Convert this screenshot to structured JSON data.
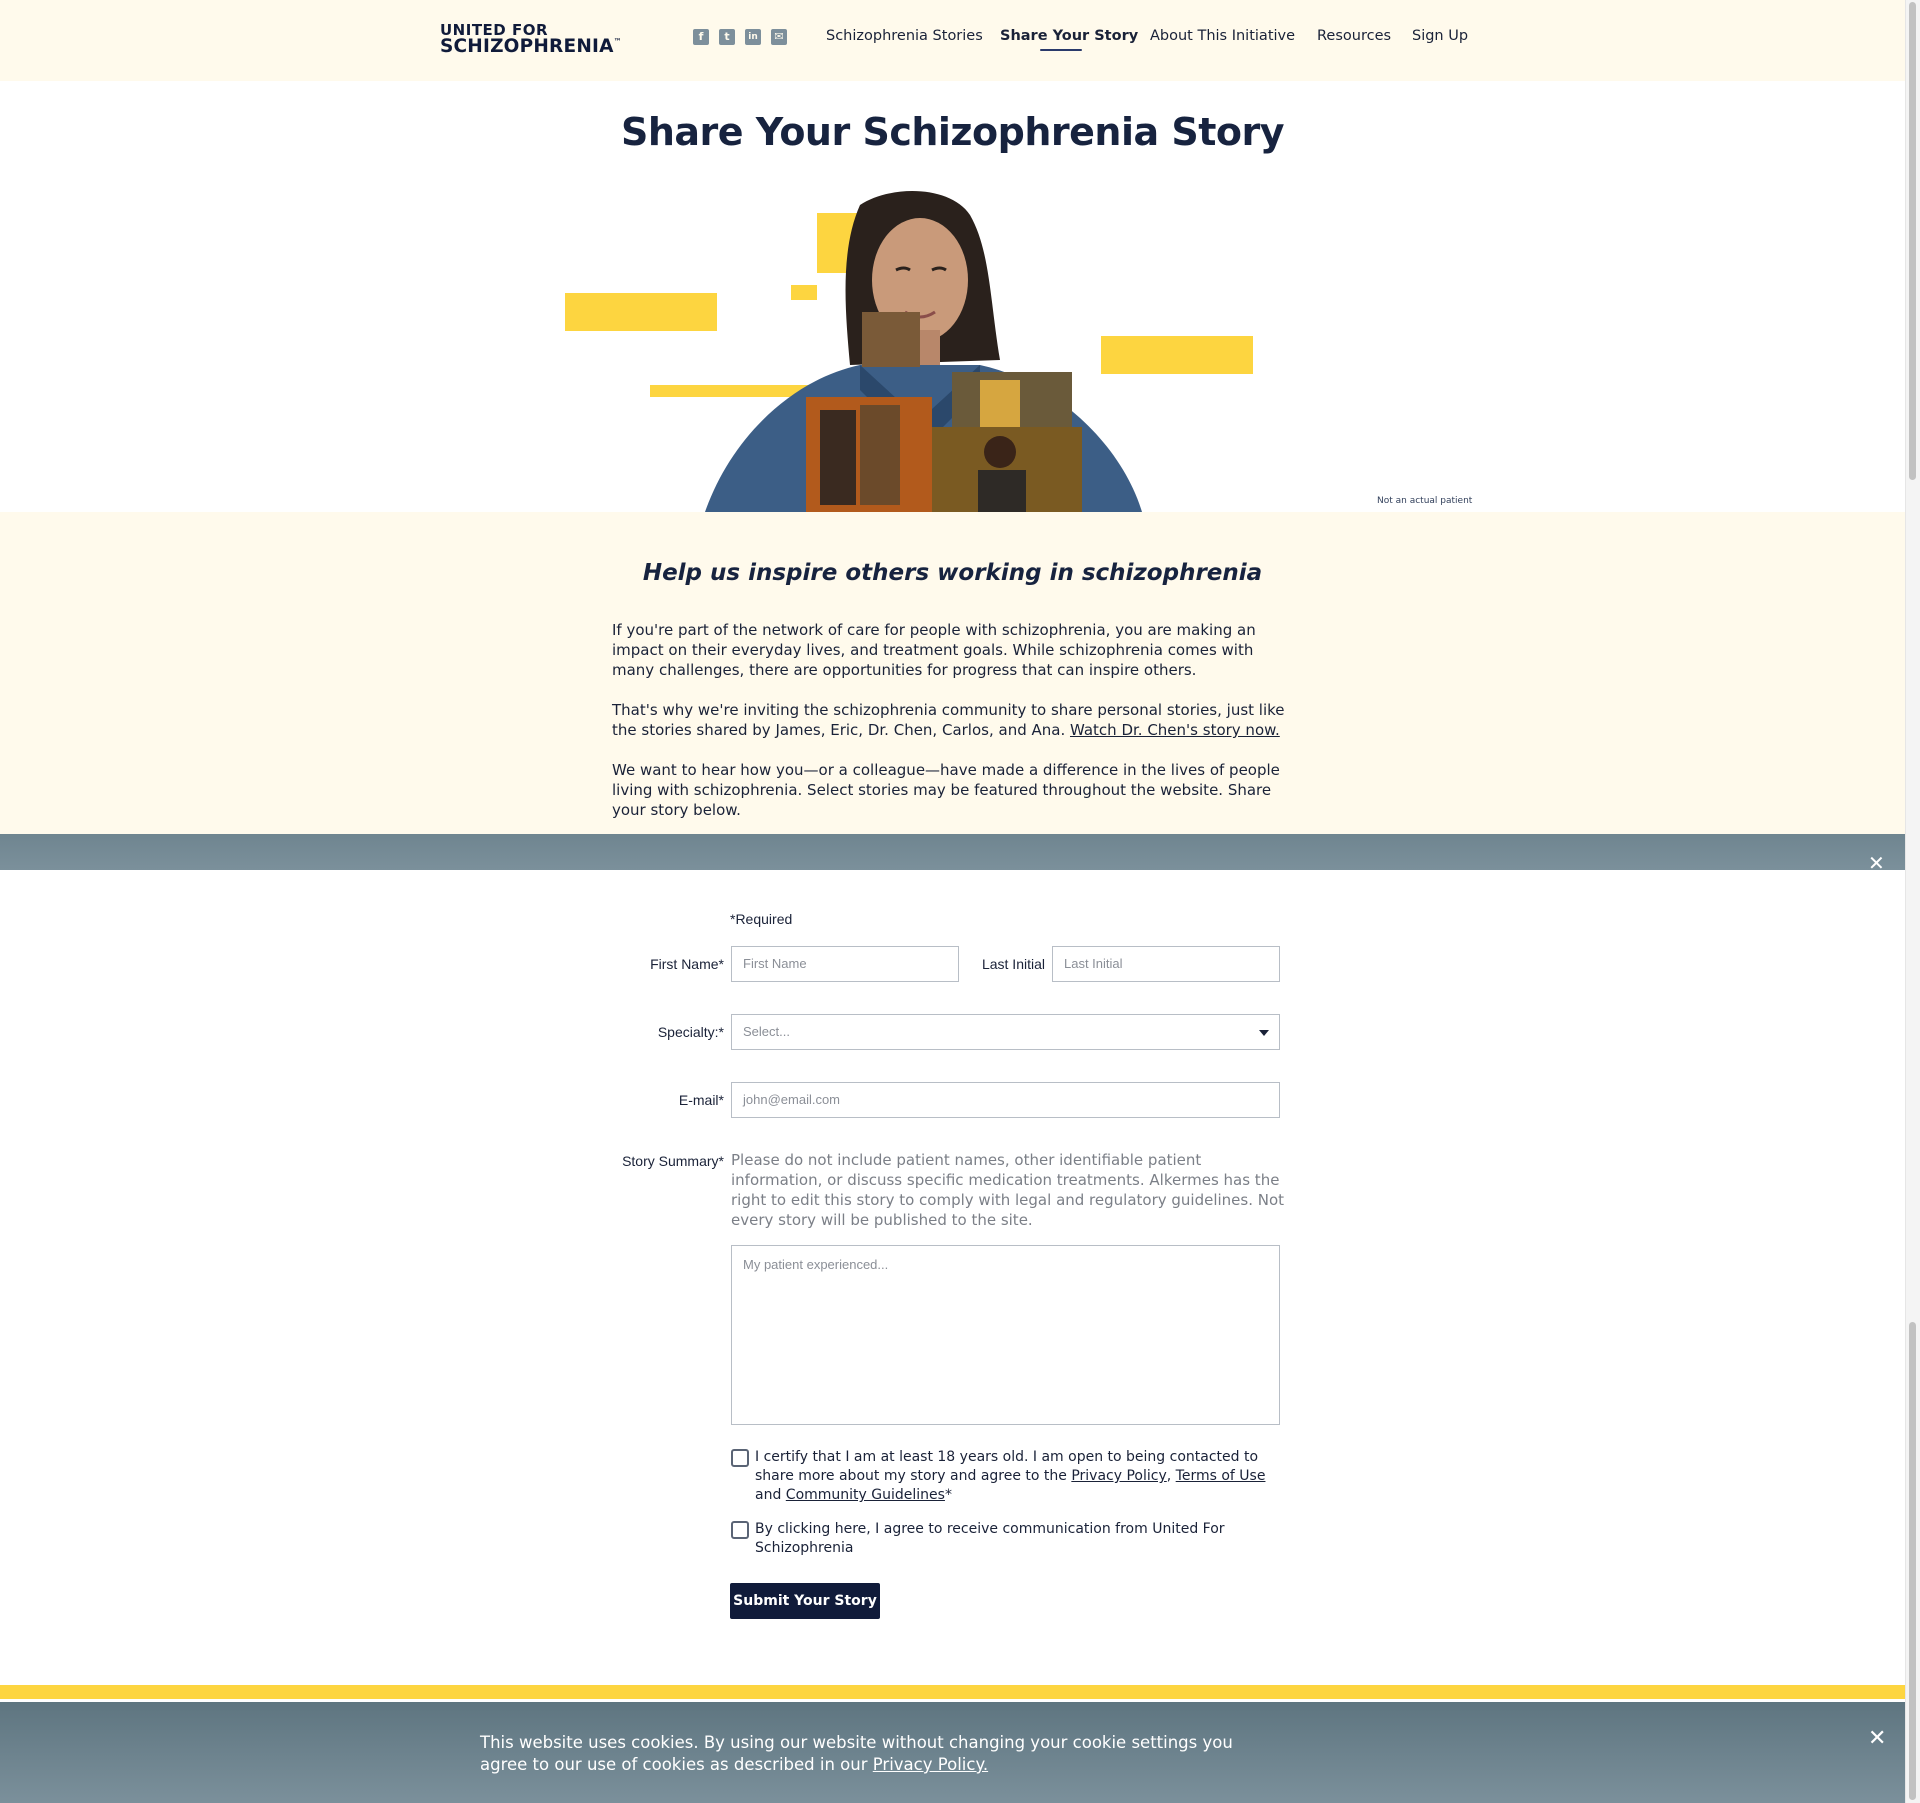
{
  "header": {
    "logo_top": "UNITED FOR",
    "logo_bottom": "SCHIZOPHRENIA",
    "logo_tm": "™",
    "social": [
      {
        "icon": "facebook-icon",
        "glyph": "f"
      },
      {
        "icon": "twitter-icon",
        "glyph": "t"
      },
      {
        "icon": "linkedin-icon",
        "glyph": "in"
      },
      {
        "icon": "email-icon",
        "glyph": "✉"
      }
    ],
    "nav": {
      "stories": "Schizophrenia Stories",
      "share": "Share Your Story",
      "about": "About This Initiative",
      "resources": "Resources",
      "signup": "Sign Up"
    },
    "active_nav": "Share Your Story"
  },
  "hero": {
    "title": "Share Your Schizophrenia Story",
    "caption": "Not an actual patient"
  },
  "intro": {
    "subtitle": "Help us inspire others working in schizophrenia",
    "p1": "If you're part of the network of care for people with schizophrenia, you are making an impact on their everyday lives, and treatment goals. While schizophrenia comes with many challenges, there are opportunities for progress that can inspire others.",
    "p2_text": "That's why we're inviting the schizophrenia community to share personal stories, just like the stories shared by James, Eric, Dr. Chen, Carlos, and Ana. ",
    "p2_link": "Watch Dr. Chen's story now.",
    "p3": "We want to hear how you—or a colleague—have made a difference in the lives of people living with schizophrenia. Select stories may be featured throughout the website. Share your story below."
  },
  "form": {
    "required_note": "*Required",
    "first_name_label": "First Name*",
    "first_name_placeholder": "First Name",
    "last_initial_label": "Last Initial",
    "last_initial_placeholder": "Last Initial",
    "specialty_label": "Specialty:*",
    "specialty_value": "Select...",
    "email_label": "E-mail*",
    "email_placeholder": "john@email.com",
    "story_label": "Story Summary*",
    "story_help": "Please do not include patient names, other identifiable patient information, or discuss specific medication treatments. Alkermes has the right to edit this story to comply with legal and regulatory guidelines. Not every story will be published to the site.",
    "story_placeholder": "My patient experienced...",
    "certify_text_1": "I certify that I am at least 18 years old. I am open to being contacted to share more about my story and agree to the ",
    "privacy_link": "Privacy Policy",
    "comma": ", ",
    "terms_link": "Terms of Use",
    "and": " and ",
    "guidelines_link": "Community Guidelines",
    "certify_req": "*",
    "consent_text": "By clicking here, I agree to receive communication from United For Schizophrenia",
    "submit_label": "Submit Your Story"
  },
  "cookie": {
    "text": "This website uses cookies. By using our website without changing your cookie settings you agree to our use of cookies as described in our ",
    "link": "Privacy Policy.",
    "close": "✕"
  },
  "overlay_close": "✕",
  "colors": {
    "navy": "#101b3a",
    "cream": "#fffaec",
    "yellow": "#fdd540",
    "slate": "#6f8590"
  }
}
